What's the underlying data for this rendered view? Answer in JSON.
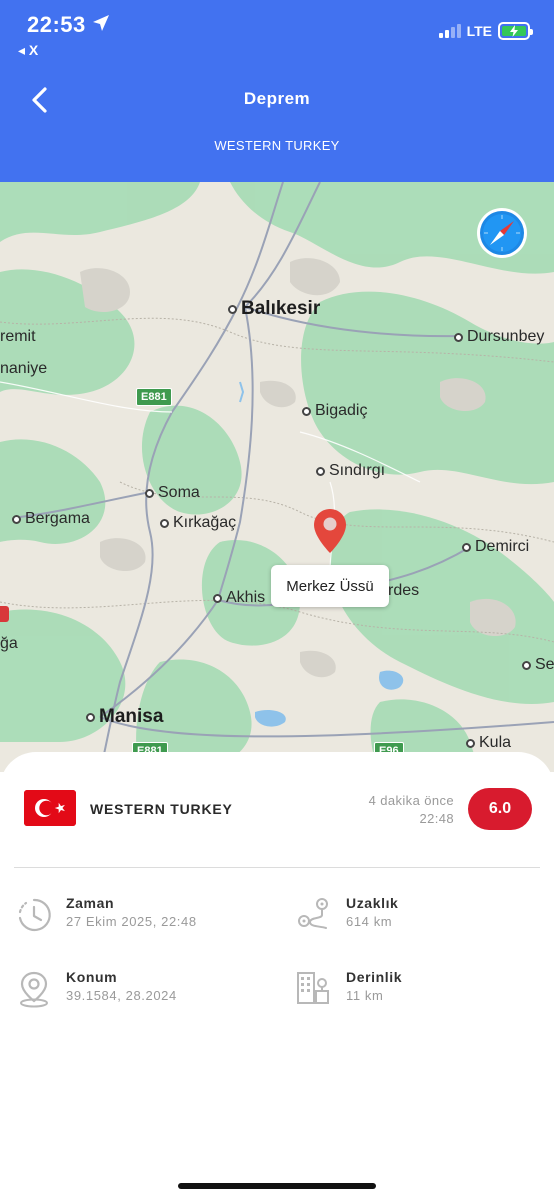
{
  "status_bar": {
    "time": "22:53",
    "back_app": "◂ X",
    "network": "LTE"
  },
  "header": {
    "title": "Deprem",
    "subtitle": "WESTERN TURKEY"
  },
  "map": {
    "labels": {
      "balikesir": "Balıkesir",
      "dursunbey": "Dursunbey",
      "edremit": "remit",
      "havran": "naniye",
      "bigadic": "Bigadiç",
      "sindirgi": "Sındırgı",
      "soma": "Soma",
      "bergama": "Bergama",
      "kirkagac": "Kırkağaç",
      "demirci": "Demirci",
      "akhisar": "Akhis",
      "gordes": "rdes",
      "aga": "ğa",
      "manisa": "Manisa",
      "kula": "Kula",
      "se": "Se"
    },
    "roads": {
      "e881_top": "E881",
      "e881_bottom": "E881",
      "e96": "E96"
    },
    "callout": "Merkez Üssü"
  },
  "card": {
    "region": "WESTERN TURKEY",
    "time_ago": "4 dakika önce",
    "time": "22:48",
    "magnitude": "6.0",
    "zaman_label": "Zaman",
    "zaman_value": "27 Ekim 2025, 22:48",
    "uzaklik_label": "Uzaklık",
    "uzaklik_value": "614 km",
    "konum_label": "Konum",
    "konum_value": "39.1584, 28.2024",
    "derinlik_label": "Derinlik",
    "derinlik_value": "11 km"
  },
  "colors": {
    "header": "#4272f0",
    "magnitude": "#d81b2e",
    "flag": "#e30a17",
    "pin": "#e4473c"
  }
}
